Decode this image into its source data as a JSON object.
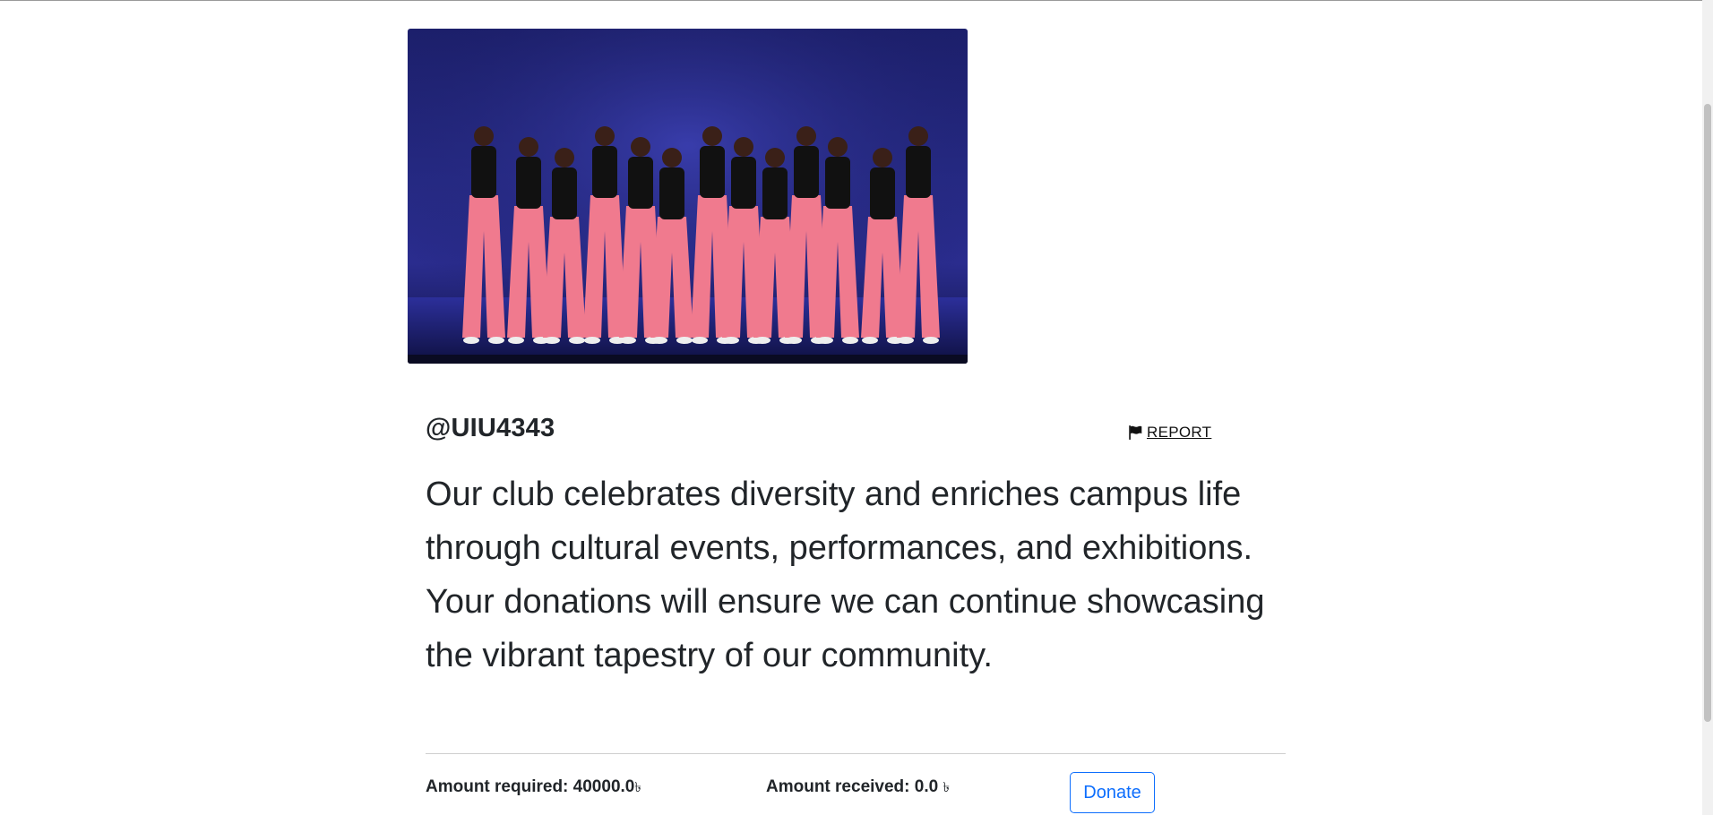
{
  "profile": {
    "handle": "@UIU4343",
    "report_label": "REPORT",
    "description": "Our club celebrates diversity and enriches campus life through cultural events, performances, and exhibitions. Your donations will ensure we can continue showcasing the vibrant tapestry of our community."
  },
  "funding": {
    "required_label": "Amount required:",
    "required_value": "40000.0",
    "received_label": "Amount received:",
    "received_value": "0.0",
    "currency_symbol": "৳",
    "donate_label": "Donate"
  },
  "icons": {
    "report": "flag-icon"
  },
  "colors": {
    "accent": "#0d6efd",
    "text": "#212529",
    "stage": "#262a86",
    "pants": "#f07a8e"
  }
}
